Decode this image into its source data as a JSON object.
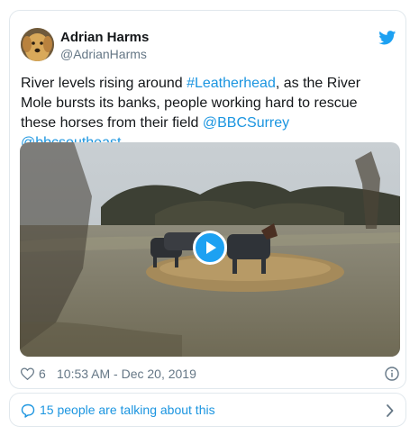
{
  "author": {
    "name": "Adrian Harms",
    "handle": "@AdrianHarms"
  },
  "tweet": {
    "text_parts": [
      {
        "text": "River levels rising around ",
        "link": false
      },
      {
        "text": "#Leatherhead",
        "link": true
      },
      {
        "text": ", as the River Mole bursts its banks, people working hard to rescue these horses from their field ",
        "link": false
      },
      {
        "text": "@BBCSurrey",
        "link": true
      },
      {
        "text": " ",
        "link": false
      },
      {
        "text": "@bbcsoutheast",
        "link": true
      }
    ]
  },
  "meta": {
    "like_count": "6",
    "timestamp": "10:53 AM - Dec 20, 2019"
  },
  "conversation": {
    "label": "15 people are talking about this"
  },
  "icons": {
    "twitter": "twitter-bird-icon",
    "like": "heart-icon",
    "info": "info-icon",
    "play": "play-icon",
    "talk": "speech-bubble-icon",
    "chevron": "chevron-right-icon"
  },
  "colors": {
    "link": "#1b95e0",
    "accent": "#1da1f2",
    "muted": "#657786",
    "border": "#e1e8ed"
  }
}
